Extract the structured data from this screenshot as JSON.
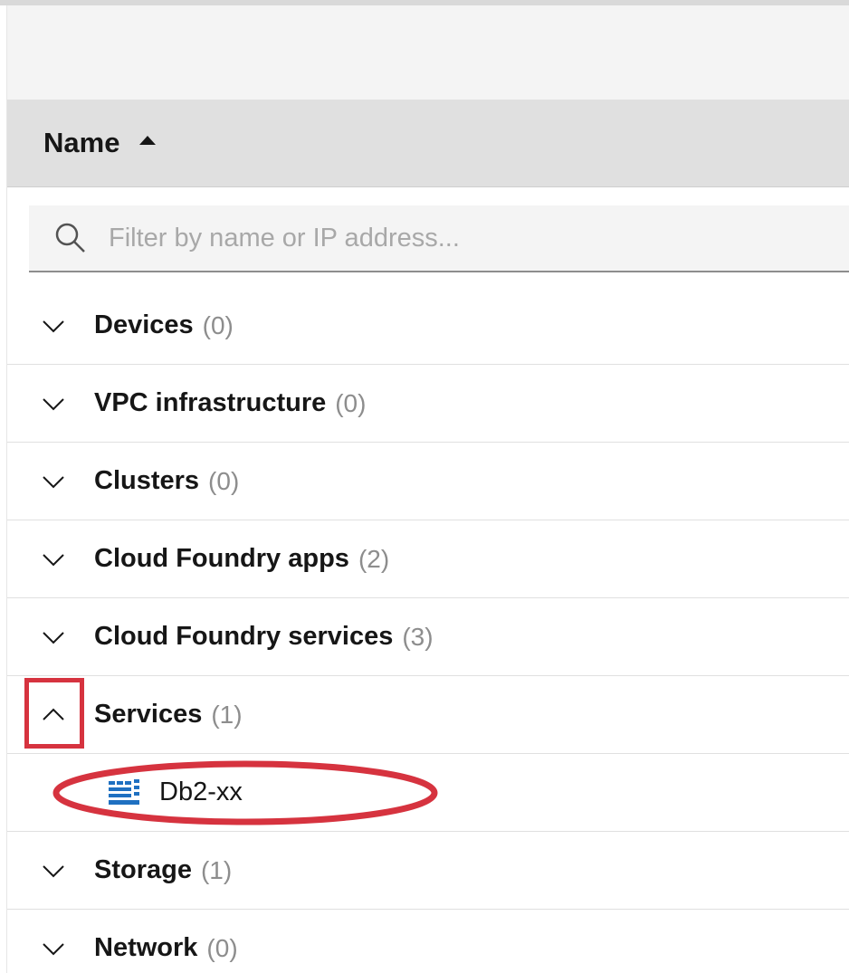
{
  "table": {
    "header_label": "Name",
    "search_placeholder": "Filter by name or IP address...",
    "rows": [
      {
        "label": "Devices",
        "count": "(0)",
        "expanded": false
      },
      {
        "label": "VPC infrastructure",
        "count": "(0)",
        "expanded": false
      },
      {
        "label": "Clusters",
        "count": "(0)",
        "expanded": false
      },
      {
        "label": "Cloud Foundry apps",
        "count": "(2)",
        "expanded": false
      },
      {
        "label": "Cloud Foundry services",
        "count": "(3)",
        "expanded": false
      },
      {
        "label": "Services",
        "count": "(1)",
        "expanded": true
      },
      {
        "label": "Storage",
        "count": "(1)",
        "expanded": false
      },
      {
        "label": "Network",
        "count": "(0)",
        "expanded": false
      }
    ],
    "services_children": [
      {
        "label": "Db2-xx",
        "icon": "database-icon"
      }
    ]
  },
  "colors": {
    "header_bg": "#e0e0e0",
    "annotation_red": "#d6333f",
    "db_icon_blue": "#1f70c1"
  }
}
